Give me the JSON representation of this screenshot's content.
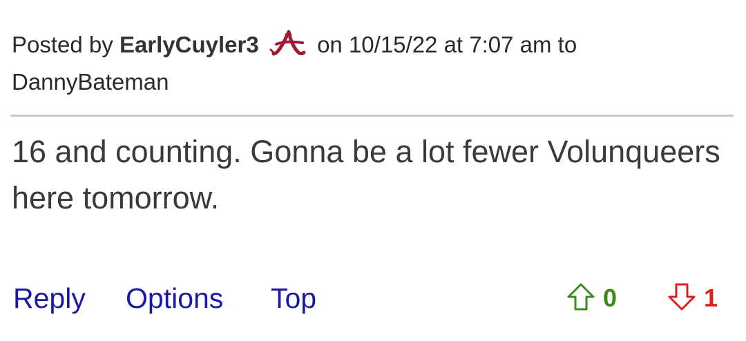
{
  "post": {
    "header": {
      "prefix": "Posted by",
      "author": "EarlyCuyler3",
      "team_logo_icon": "alabama-a-logo-icon",
      "team_logo_color": "#9e1b32",
      "date_text": "on 10/15/22 at 7:07 am to",
      "reply_to": "DannyBateman"
    },
    "body": {
      "text": "16 and counting. Gonna be a lot fewer Volunqueers here tomorrow."
    },
    "footer": {
      "reply_label": "Reply",
      "options_label": "Options",
      "top_label": "Top",
      "upvote_icon": "up-arrow-icon",
      "upvote_count": "0",
      "upvote_color": "#3a8a1c",
      "downvote_icon": "down-arrow-icon",
      "downvote_count": "1",
      "downvote_color": "#e11d1d"
    }
  }
}
